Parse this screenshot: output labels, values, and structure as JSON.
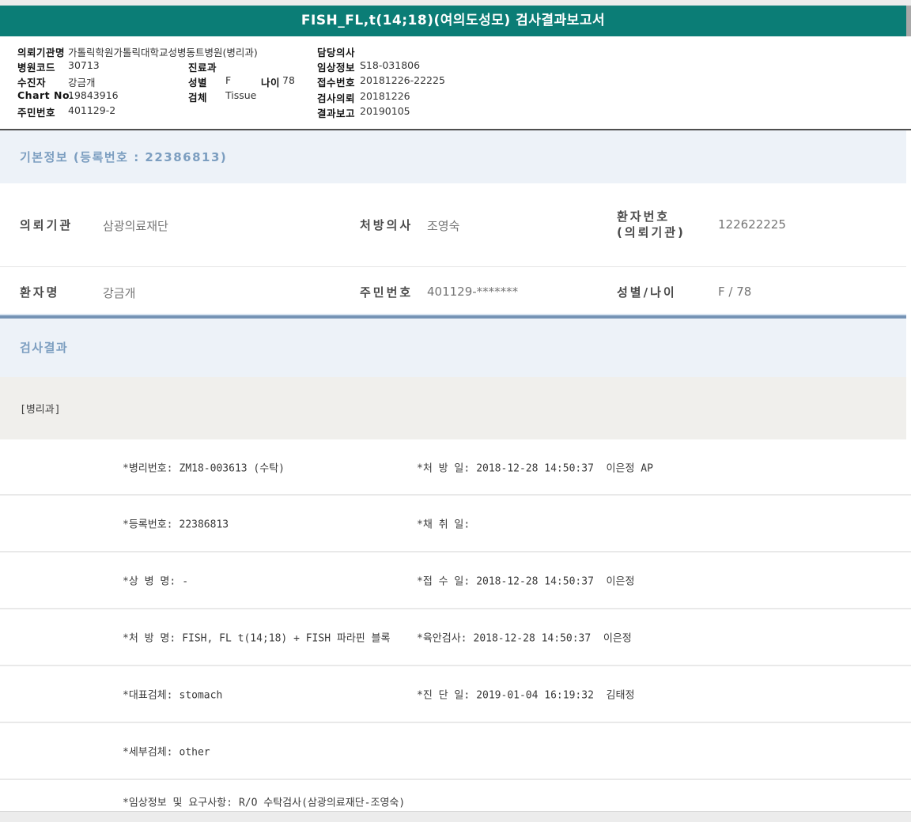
{
  "title": "FISH_FL,t(14;18)(여의도성모) 검사결과보고서",
  "colors": {
    "header_bar": "#0B7D76",
    "section_title_text": "#7C9EC0",
    "section_band_bg": "#EDF2F8",
    "dept_band_bg": "#F0EFEC",
    "steel_divider": "#7593B5",
    "page_edge": "#ECECEC"
  },
  "header": {
    "left": [
      {
        "label": "의뢰기관명",
        "value": "가톨릭학원가톨릭대학교성병동트병원(병리과)"
      },
      {
        "label": "병원코드",
        "value": "30713"
      },
      {
        "label": "수진자",
        "value": "강금개"
      },
      {
        "label": "Chart No.",
        "value": "19843916"
      },
      {
        "label": "주민번호",
        "value": "401129-2"
      }
    ],
    "middle": [
      {
        "label": "진료과",
        "value": ""
      },
      {
        "label": "성별",
        "value": "F",
        "label2": "나이",
        "value2": "78"
      },
      {
        "label": "검체",
        "value": "Tissue"
      }
    ],
    "right": [
      {
        "label": "담당의사",
        "value": ""
      },
      {
        "label": "임상정보",
        "value": "S18-031806"
      },
      {
        "label": "접수번호",
        "value": "20181226-22225"
      },
      {
        "label": "검사의뢰",
        "value": "20181226"
      },
      {
        "label": "결과보고",
        "value": "20190105"
      }
    ]
  },
  "basic_info": {
    "heading": "기본정보 (등록번호 : 22386813)",
    "rows": {
      "row1": {
        "col1_label": "의뢰기관",
        "col1_value": "삼광의료재단",
        "col2_label": "처방의사",
        "col2_value": "조영숙",
        "col3_label_line1": "환자번호",
        "col3_label_line2": "(의뢰기관)",
        "col3_value": "122622225"
      },
      "row2": {
        "col1_label": "환자명",
        "col1_value": "강금개",
        "col2_label": "주민번호",
        "col2_value": "401129-*******",
        "col3_label": "성별/나이",
        "col3_value": "F / 78"
      }
    }
  },
  "results": {
    "heading": "검사결과",
    "department": "[병리과]",
    "rows": [
      {
        "left_label": "*병리번호:",
        "left_value": "ZM18-003613 (수탁)",
        "right_label": "*처 방 일:",
        "right_value": "2018-12-28 14:50:37  이은정 AP"
      },
      {
        "left_label": "*등록번호:",
        "left_value": "22386813",
        "right_label": "*채 취 일:",
        "right_value": ""
      },
      {
        "left_label": "*상 병 명:",
        "left_value": "-",
        "right_label": "*접 수 일:",
        "right_value": "2018-12-28 14:50:37  이은정"
      },
      {
        "left_label": "*처 방 명:",
        "left_value": "FISH, FL t(14;18) + FISH 파라핀 블록",
        "right_label": "*육안검사:",
        "right_value": "2018-12-28 14:50:37  이은정"
      },
      {
        "left_label": "*대표검체:",
        "left_value": "stomach",
        "right_label": "*진 단 일:",
        "right_value": "2019-01-04 16:19:32  김태정"
      },
      {
        "left_label": "*세부검체:",
        "left_value": "other",
        "right_label": "",
        "right_value": ""
      },
      {
        "left_label": "*임상정보 및 요구사항:",
        "left_value": "R/O 수탁검사(삼광의료재단-조영숙)",
        "right_label": "",
        "right_value": ""
      }
    ]
  }
}
